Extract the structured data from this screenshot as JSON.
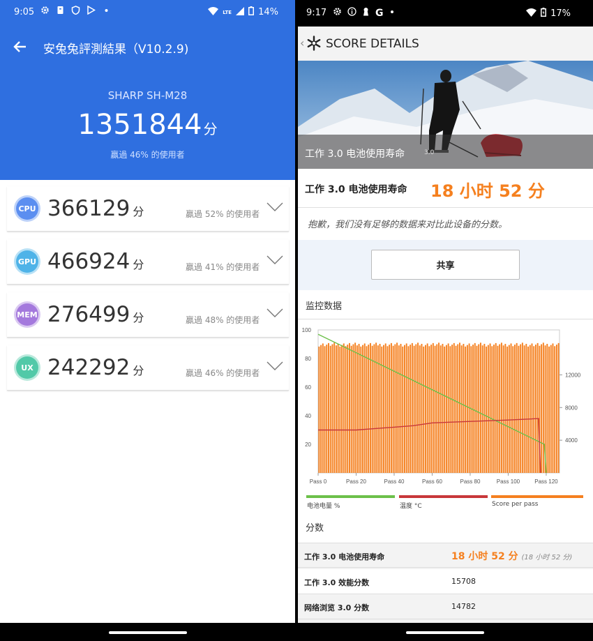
{
  "left": {
    "status": {
      "time": "9:05",
      "battery": "14%",
      "network": "LTE"
    },
    "title": "安兔兔評測結果（V10.2.9)",
    "device": "SHARP SH-M28",
    "total_score": "1351844",
    "unit": "分",
    "beat": "贏過 46% 的使用者",
    "subscores": [
      {
        "badge": "CPU",
        "color": "#5b8ef0",
        "score": "366129",
        "pct": "贏過 52% 的使用者"
      },
      {
        "badge": "GPU",
        "color": "#4fb3e8",
        "score": "466924",
        "pct": "贏過 41% 的使用者"
      },
      {
        "badge": "MEM",
        "color": "#a479dd",
        "score": "276499",
        "pct": "贏過 48% 的使用者"
      },
      {
        "badge": "UX",
        "color": "#52c9a8",
        "score": "242292",
        "pct": "贏過 46% 的使用者"
      }
    ]
  },
  "right": {
    "status": {
      "time": "9:17",
      "battery": "17%",
      "g": "G"
    },
    "header_title": "SCORE DETAILS",
    "hero_caption": "工作 3.0 电池使用寿命",
    "hero_version": "3.0",
    "result_label": "工作 3.0 电池使用寿命",
    "result_value": "18 小时 52 分",
    "sorry_text": "抱歉，我们没有足够的数据来对比此设备的分数。",
    "share_label": "共享",
    "monitor_title": "监控数据",
    "legend": [
      {
        "label": "电池电量 %",
        "color": "#6cc04a"
      },
      {
        "label": "温度 °C",
        "color": "#c8373a"
      },
      {
        "label": "Score per pass",
        "color": "#f5801f"
      }
    ],
    "scores_title": "分数",
    "score_rows": [
      {
        "k": "工作 3.0 电池使用寿命",
        "v": "18 小时 52 分",
        "sub": "(18 小时 52 分)"
      },
      {
        "k": "工作 3.0 效能分数",
        "v": "15708"
      },
      {
        "k": "网络浏览 3.0 分数",
        "v": "14782"
      }
    ]
  },
  "chart_data": {
    "type": "bar",
    "title": "监控数据",
    "x_ticks": [
      "Pass 0",
      "Pass 20",
      "Pass 40",
      "Pass 60",
      "Pass 80",
      "Pass 100",
      "Pass 120"
    ],
    "xlim": [
      0,
      127
    ],
    "y_left_ticks": [
      "100",
      "80",
      "60",
      "40",
      "20"
    ],
    "y_left_lim": [
      0,
      100
    ],
    "y_right_ticks": [
      "12000",
      "8000",
      "4000"
    ],
    "y_right_lim": [
      0,
      17500
    ],
    "bars_per_pass_score": {
      "count": 127,
      "approx_value": 15700
    },
    "battery_line": [
      [
        0,
        97
      ],
      [
        119,
        20
      ],
      [
        120,
        0
      ]
    ],
    "temperature_line": [
      [
        0,
        30
      ],
      [
        20,
        30
      ],
      [
        30,
        31
      ],
      [
        40,
        32
      ],
      [
        50,
        33
      ],
      [
        60,
        35
      ],
      [
        80,
        36
      ],
      [
        100,
        37
      ],
      [
        116,
        38
      ],
      [
        117,
        0
      ]
    ],
    "series": [
      {
        "name": "电池电量 %"
      },
      {
        "name": "温度 °C"
      },
      {
        "name": "Score per pass"
      }
    ]
  }
}
